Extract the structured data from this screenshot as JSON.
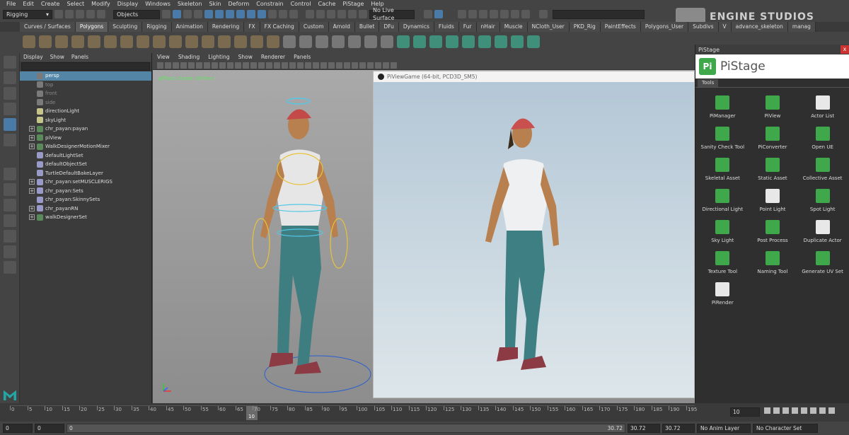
{
  "menubar": [
    "File",
    "Edit",
    "Create",
    "Select",
    "Modify",
    "Display",
    "Windows",
    "Skeleton",
    "Skin",
    "Deform",
    "Constrain",
    "Control",
    "Cache",
    "PiStage",
    "Help"
  ],
  "status": {
    "mode": "Rigging",
    "objects": "Objects",
    "live_surface": "No Live Surface"
  },
  "brand": {
    "name": "ENGINE STUDIOS"
  },
  "shelf_tabs": [
    "Curves / Surfaces",
    "Polygons",
    "Sculpting",
    "Rigging",
    "Animation",
    "Rendering",
    "FX",
    "FX Caching",
    "Custom",
    "Arnold",
    "Bullet",
    "DFu",
    "Dynamics",
    "Fluids",
    "Fur",
    "nHair",
    "Muscle",
    "NCloth_User",
    "PKD_Rig",
    "PaintEffects",
    "Polygons_User",
    "Subdivs",
    "V",
    "advance_skeleton",
    "manag"
  ],
  "active_shelf_tab": "Polygons",
  "outliner": {
    "menu": [
      "Display",
      "Show",
      "Panels"
    ],
    "items": [
      {
        "label": "persp",
        "type": "cam",
        "selected": true,
        "dim": false,
        "expand": false
      },
      {
        "label": "top",
        "type": "cam",
        "selected": false,
        "dim": true,
        "expand": false
      },
      {
        "label": "front",
        "type": "cam",
        "selected": false,
        "dim": true,
        "expand": false
      },
      {
        "label": "side",
        "type": "cam",
        "selected": false,
        "dim": true,
        "expand": false
      },
      {
        "label": "directionLight",
        "type": "lt",
        "selected": false,
        "dim": false,
        "expand": false
      },
      {
        "label": "skyLight",
        "type": "lt",
        "selected": false,
        "dim": false,
        "expand": false
      },
      {
        "label": "chr_payan:payan",
        "type": "grp",
        "selected": false,
        "dim": false,
        "expand": true
      },
      {
        "label": "piView",
        "type": "grp",
        "selected": false,
        "dim": false,
        "expand": true
      },
      {
        "label": "WalkDesignerMotionMixer",
        "type": "grp",
        "selected": false,
        "dim": false,
        "expand": true
      },
      {
        "label": "defaultLightSet",
        "type": "set",
        "selected": false,
        "dim": false,
        "expand": false
      },
      {
        "label": "defaultObjectSet",
        "type": "set",
        "selected": false,
        "dim": false,
        "expand": false
      },
      {
        "label": "TurtleDefaultBakeLayer",
        "type": "set",
        "selected": false,
        "dim": false,
        "expand": false
      },
      {
        "label": "chr_payan:setMUSCLERIGS",
        "type": "set",
        "selected": false,
        "dim": false,
        "expand": true
      },
      {
        "label": "chr_payan:Sets",
        "type": "set",
        "selected": false,
        "dim": false,
        "expand": true
      },
      {
        "label": "chr_payan:SkinnySets",
        "type": "set",
        "selected": false,
        "dim": false,
        "expand": false
      },
      {
        "label": "chr_payanRN",
        "type": "set",
        "selected": false,
        "dim": false,
        "expand": true
      },
      {
        "label": "walkDesignerSet",
        "type": "grp",
        "selected": false,
        "dim": false,
        "expand": true
      }
    ]
  },
  "viewport": {
    "menu": [
      "View",
      "Shading",
      "Lighting",
      "Show",
      "Renderer",
      "Panels"
    ],
    "label": "piPlace Scene: Online !"
  },
  "game_window": {
    "title": "PiViewGame (64-bit, PCD3D_SM5)"
  },
  "pistage": {
    "title": "PiStage",
    "close": "x",
    "logo_letter": "Pi",
    "name": "PiStage",
    "tab": "Tools",
    "tools": [
      {
        "label": "PiManager",
        "icon": "manager-icon",
        "light": false
      },
      {
        "label": "PiView",
        "icon": "view-icon",
        "light": false
      },
      {
        "label": "Actor List",
        "icon": "list-icon",
        "light": true
      },
      {
        "label": "Sanity Check Tool",
        "icon": "check-icon",
        "light": false
      },
      {
        "label": "PiConverter",
        "icon": "converter-icon",
        "light": false
      },
      {
        "label": "Open UE",
        "icon": "unreal-icon",
        "light": false
      },
      {
        "label": "Skeletal Asset",
        "icon": "skeleton-icon",
        "light": false
      },
      {
        "label": "Static Asset",
        "icon": "static-icon",
        "light": false
      },
      {
        "label": "Collective Asset",
        "icon": "collective-icon",
        "light": false
      },
      {
        "label": "Directional Light",
        "icon": "dirlight-icon",
        "light": false
      },
      {
        "label": "Point Light",
        "icon": "pointlight-icon",
        "light": true
      },
      {
        "label": "Spot Light",
        "icon": "spotlight-icon",
        "light": false
      },
      {
        "label": "Sky Light",
        "icon": "skylight-icon",
        "light": false
      },
      {
        "label": "Post Process",
        "icon": "postprocess-icon",
        "light": false
      },
      {
        "label": "Duplicate Actor",
        "icon": "duplicate-icon",
        "light": true
      },
      {
        "label": "Texture Tool",
        "icon": "texture-icon",
        "light": false
      },
      {
        "label": "Naming Tool",
        "icon": "abc-icon",
        "light": false
      },
      {
        "label": "Generate UV Set",
        "icon": "uv-icon",
        "light": false
      },
      {
        "label": "PiRender",
        "icon": "clapper-icon",
        "light": true
      }
    ]
  },
  "timeline": {
    "ticks": [
      "0",
      "5",
      "10",
      "15",
      "20",
      "25",
      "30",
      "35",
      "40",
      "45",
      "50",
      "55",
      "60",
      "65",
      "70",
      "75",
      "80",
      "85",
      "90",
      "95",
      "100",
      "105",
      "110",
      "115",
      "120",
      "125",
      "130",
      "135",
      "140",
      "145",
      "150",
      "155",
      "160",
      "165",
      "170",
      "175",
      "180",
      "185",
      "190",
      "195"
    ],
    "current": "10",
    "frame_field": "10"
  },
  "range": {
    "start": "0",
    "start2": "0",
    "slider_start": "0",
    "slider_end": "30.72",
    "end": "30.72",
    "end2": "30.72",
    "anim_layer": "No Anim Layer",
    "char_set": "No Character Set"
  }
}
